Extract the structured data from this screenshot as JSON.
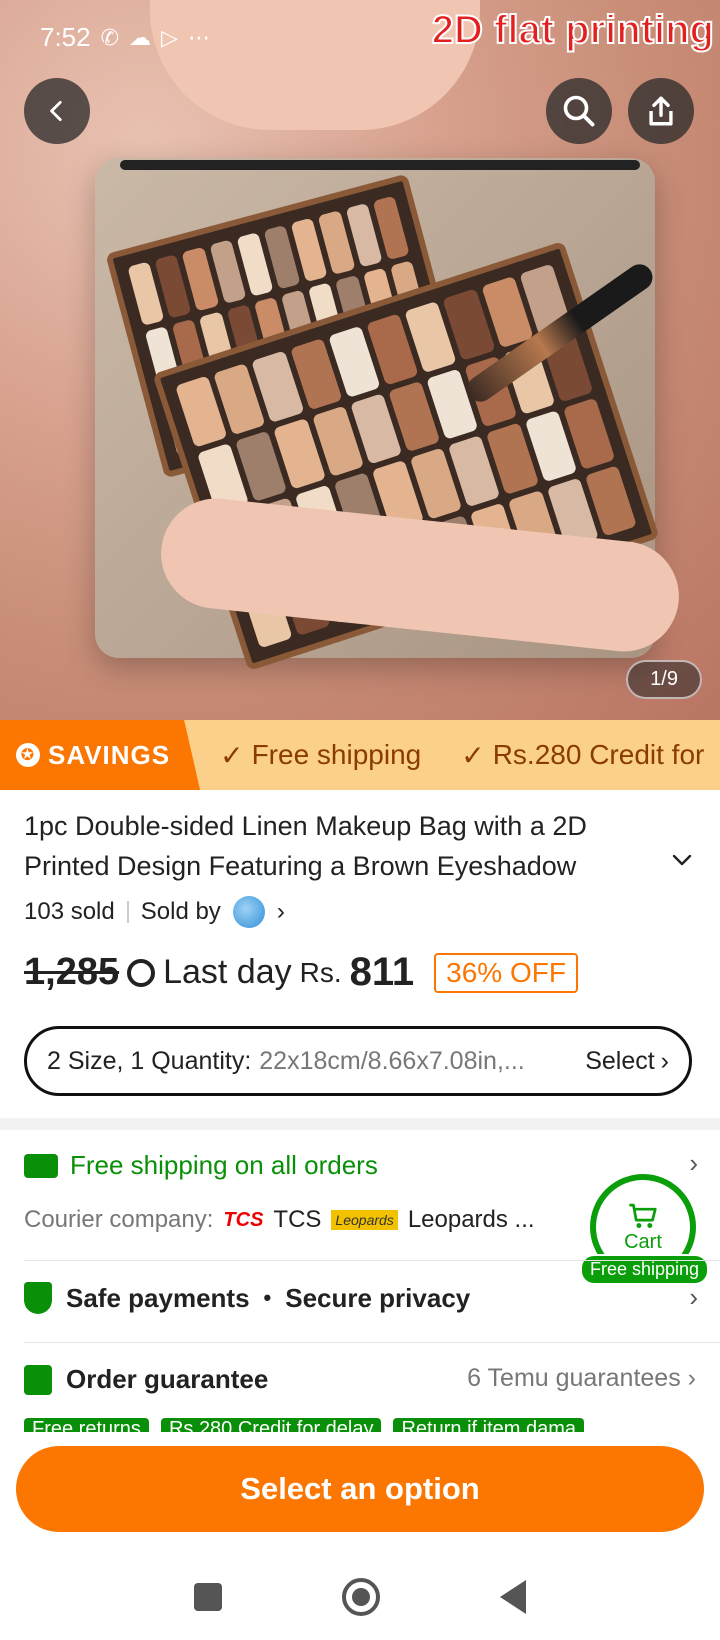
{
  "status_bar": {
    "time": "7:52",
    "icons": [
      "whatsapp-icon",
      "cloud-icon",
      "play-icon",
      "more-dots-icon"
    ]
  },
  "hero": {
    "overlay_text": "2D flat printing",
    "counter": "1/9"
  },
  "promo": {
    "savings_label": "SAVINGS",
    "items": [
      "Free shipping",
      "Rs.280 Credit for"
    ]
  },
  "product": {
    "title": "1pc Double-sided Linen Makeup Bag with a 2D Printed Design Featuring a Brown Eyeshadow",
    "sold": "103 sold",
    "sold_by": "Sold by"
  },
  "price": {
    "old_price": "1,285",
    "last_day": "Last day",
    "currency": "Rs.",
    "current": "811",
    "discount": "36% OFF"
  },
  "variant": {
    "label": "2 Size, 1 Quantity:",
    "value": "22x18cm/8.66x7.08in,...",
    "select": "Select"
  },
  "shipping": {
    "title": "Free shipping on all orders",
    "courier_label": "Courier company:",
    "courier1": "TCS",
    "courier1_logo": "TCS",
    "courier2": "Leopards ...",
    "courier2_logo": "Leopards"
  },
  "cart": {
    "label": "Cart",
    "badge": "Free shipping"
  },
  "safety": {
    "left": "Safe payments",
    "dot": "•",
    "right": "Secure privacy"
  },
  "guarantee": {
    "title": "Order guarantee",
    "right": "6 Temu guarantees",
    "chips": [
      "Free returns",
      "Rs.280 Credit for delay",
      "Return if item dama"
    ]
  },
  "cta": {
    "label": "Select an option"
  },
  "colors": {
    "accent": "#fb7701",
    "green": "#0a8f08",
    "promo_bg": "#fbd08b"
  }
}
